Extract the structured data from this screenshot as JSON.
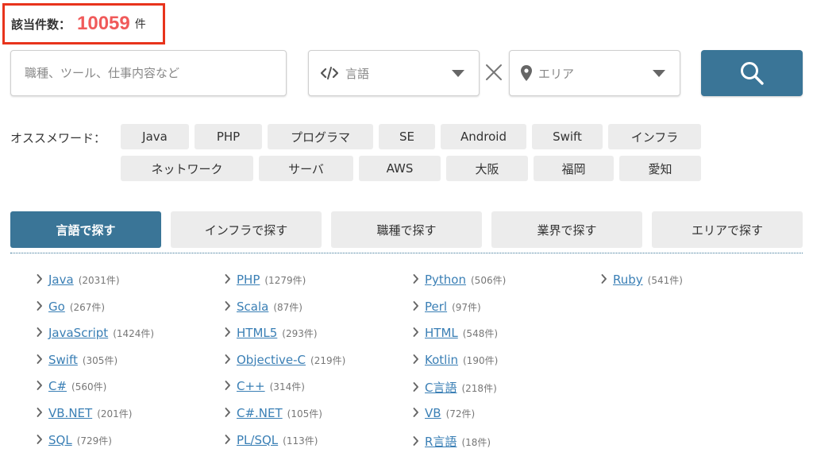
{
  "result": {
    "label": "該当件数：",
    "count": "10059",
    "unit": "件"
  },
  "search": {
    "keyword_placeholder": "職種、ツール、仕事内容など",
    "language_placeholder": "言語",
    "area_placeholder": "エリア"
  },
  "recommend": {
    "label": "オススメワード：",
    "row1": [
      "Java",
      "PHP",
      "プログラマ",
      "SE",
      "Android",
      "Swift",
      "インフラ"
    ],
    "row2": [
      "ネットワーク",
      "サーバ",
      "AWS",
      "大阪",
      "福岡",
      "愛知"
    ]
  },
  "tabs": [
    "言語で探す",
    "インフラで探す",
    "職種で探す",
    "業界で探す",
    "エリアで探す"
  ],
  "languages": {
    "col1": [
      {
        "name": "Java",
        "count": "(2031件)"
      },
      {
        "name": "Go",
        "count": "(267件)"
      },
      {
        "name": "JavaScript",
        "count": "(1424件)"
      },
      {
        "name": "Swift",
        "count": "(305件)"
      },
      {
        "name": "C#",
        "count": "(560件)"
      },
      {
        "name": "VB.NET",
        "count": "(201件)"
      },
      {
        "name": "SQL",
        "count": "(729件)"
      }
    ],
    "col2": [
      {
        "name": "PHP",
        "count": "(1279件)"
      },
      {
        "name": "Scala",
        "count": "(87件)"
      },
      {
        "name": "HTML5",
        "count": "(293件)"
      },
      {
        "name": "Objective-C",
        "count": "(219件)"
      },
      {
        "name": "C++",
        "count": "(314件)"
      },
      {
        "name": "C#.NET",
        "count": "(105件)"
      },
      {
        "name": "PL/SQL",
        "count": "(113件)"
      }
    ],
    "col3": [
      {
        "name": "Python",
        "count": "(506件)"
      },
      {
        "name": "Perl",
        "count": "(97件)"
      },
      {
        "name": "HTML",
        "count": "(548件)"
      },
      {
        "name": "Kotlin",
        "count": "(190件)"
      },
      {
        "name": "C言語",
        "count": "(218件)"
      },
      {
        "name": "VB",
        "count": "(72件)"
      },
      {
        "name": "R言語",
        "count": "(18件)"
      }
    ],
    "col4": [
      {
        "name": "Ruby",
        "count": "(541件)"
      }
    ]
  },
  "colors": {
    "accent": "#3a7597",
    "highlight": "#e8341c",
    "count": "#f05a5a",
    "link": "#3a7fb5"
  },
  "icons": [
    "code-icon",
    "map-pin-icon",
    "times-icon",
    "search-icon",
    "chevron-right-icon",
    "chevron-down-icon"
  ]
}
